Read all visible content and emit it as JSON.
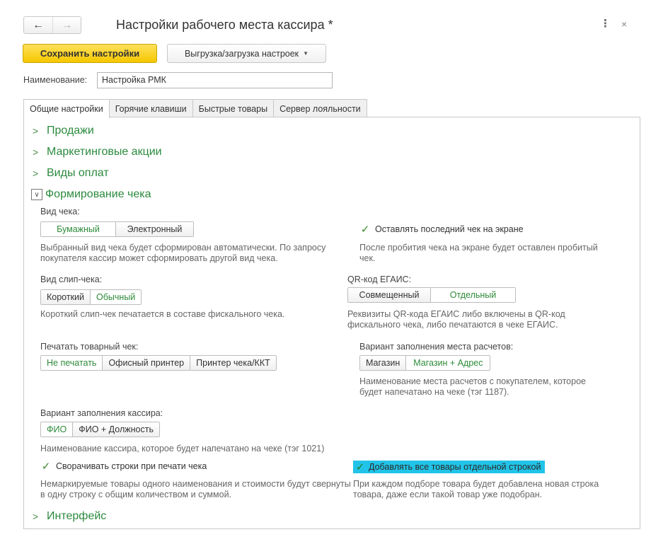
{
  "window": {
    "title": "Настройки рабочего места кассира *",
    "back_icon": "←",
    "forward_icon": "→",
    "more_icon": "⋮",
    "close_icon": "×"
  },
  "toolbar": {
    "save_label": "Сохранить настройки",
    "export_label": "Выгрузка/загрузка настроек",
    "export_caret": "▼"
  },
  "name_field": {
    "label": "Наименование:",
    "value": "Настройка РМК"
  },
  "tabs": [
    {
      "label": "Общие настройки",
      "active": true
    },
    {
      "label": "Горячие клавиши",
      "active": false
    },
    {
      "label": "Быстрые товары",
      "active": false
    },
    {
      "label": "Сервер лояльности",
      "active": false
    }
  ],
  "sections": {
    "sales": "Продажи",
    "marketing": "Маркетинговые акции",
    "payments": "Виды оплат",
    "receipt": "Формирование чека",
    "interface": "Интерфейс"
  },
  "receipt": {
    "receipt_type": {
      "label": "Вид чека:",
      "options": [
        "Бумажный",
        "Электронный"
      ],
      "selected": "Бумажный",
      "hint": "Выбранный вид чека будет сформирован автоматически. По запросу покупателя кассир может сформировать другой вид чека."
    },
    "keep_last": {
      "label": "Оставлять последний чек на экране",
      "checked": true,
      "hint": "После пробития чека на экране будет оставлен пробитый чек."
    },
    "slip_type": {
      "label": "Вид слип-чека:",
      "options": [
        "Короткий",
        "Обычный"
      ],
      "selected": "Обычный",
      "hint": "Короткий слип-чек печатается  в составе фискального чека."
    },
    "qr_egais": {
      "label": "QR-код ЕГАИС:",
      "options": [
        "Совмещенный",
        "Отдельный"
      ],
      "selected": "Отдельный",
      "hint": "Реквизиты QR-кода ЕГАИС либо включены в QR-код фискального чека, либо печатаются в чеке ЕГАИС."
    },
    "print_goods": {
      "label": "Печатать товарный чек:",
      "options": [
        "Не печатать",
        "Офисный принтер",
        "Принтер чека/ККТ"
      ],
      "selected": "Не печатать"
    },
    "settlement_place": {
      "label": "Вариант заполнения места расчетов:",
      "options": [
        "Магазин",
        "Магазин + Адрес"
      ],
      "selected": "Магазин + Адрес",
      "hint": "Наименование места расчетов с покупателем, которое будет напечатано на чеке (тэг 1187)."
    },
    "cashier_fill": {
      "label": "Вариант заполнения кассира:",
      "options": [
        "ФИО",
        "ФИО + Должность"
      ],
      "selected": "ФИО",
      "hint": "Наименование кассира, которое будет напечатано на чеке (тэг 1021)"
    },
    "collapse_rows": {
      "label": "Сворачивать строки при печати чека",
      "checked": true,
      "hint": "Немаркируемые товары одного наименования и стоимости будут свернуты в одну строку с общим количеством и суммой."
    },
    "separate_rows": {
      "label": "Добавлять все товары отдельной строкой",
      "checked": true,
      "highlighted": true,
      "hint": "При каждом подборе товара будет добавлена новая строка товара, даже если такой товар уже подобран."
    }
  },
  "colors": {
    "accent_green": "#2b8a3e",
    "primary_button": "#f5c700",
    "highlight": "#21c4e8"
  }
}
